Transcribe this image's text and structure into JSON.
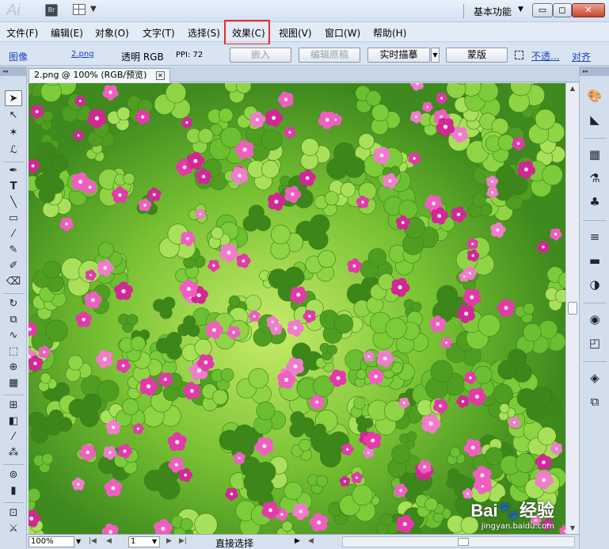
{
  "app": {
    "logo": "Ai",
    "bridge_label": "Br",
    "workspace": "基本功能"
  },
  "window_controls": {
    "minimize": "▭",
    "maximize": "◻",
    "close": "✕"
  },
  "menu": {
    "items": [
      "文件(F)",
      "编辑(E)",
      "对象(O)",
      "文字(T)",
      "选择(S)",
      "效果(C)",
      "视图(V)",
      "窗口(W)",
      "帮助(H)"
    ],
    "highlighted_item": "效果(C)",
    "highlight_color": "#e0322b"
  },
  "control_bar": {
    "selection_type": "图像",
    "file_link": "2.png",
    "color_mode": "透明 RGB",
    "ppi": "PPI: 72",
    "embed_button": "嵌入",
    "edit_original_button": "编辑原稿",
    "live_trace_button": "实时描摹",
    "mask_button": "蒙版",
    "opacity_link": "不透...",
    "align_link": "对齐"
  },
  "document": {
    "tab_title": "2.png @ 100% (RGB/预览)"
  },
  "status_bar": {
    "zoom": "100%",
    "page": "1",
    "current_tool": "直接选择"
  },
  "watermark": {
    "brand": "Bai🐾经验",
    "url": "jingyan.baidu.com"
  },
  "colors": {
    "leaf_green": "#64b52d",
    "flower_pink": "#e23aa8"
  }
}
